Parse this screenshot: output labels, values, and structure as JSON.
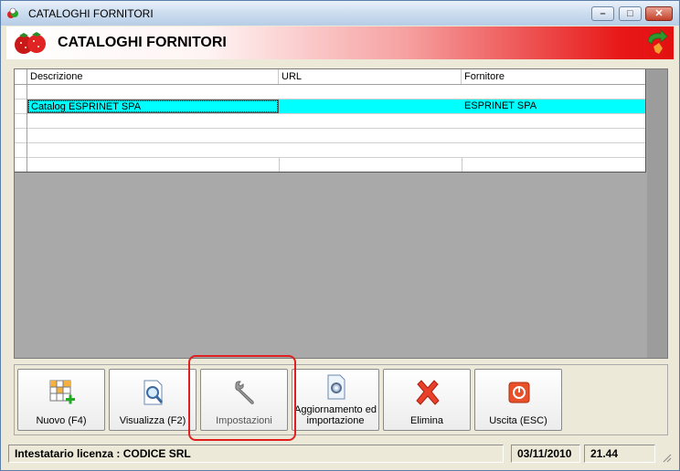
{
  "window": {
    "title": "CATALOGHI FORNITORI"
  },
  "header": {
    "title": "CATALOGHI FORNITORI"
  },
  "grid": {
    "columns": [
      "Descrizione",
      "URL",
      "Fornitore"
    ],
    "rows": [
      {
        "descrizione": "Catalog ESPRINET SPA",
        "url": "",
        "fornitore": "ESPRINET SPA",
        "selected": true
      }
    ]
  },
  "toolbar": {
    "buttons": [
      {
        "label": "Nuovo (F4)",
        "icon": "grid-add-icon"
      },
      {
        "label": "Visualizza (F2)",
        "icon": "magnifier-document-icon"
      },
      {
        "label": "Impostazioni",
        "icon": "wrench-icon"
      },
      {
        "label": "Aggiornamento ed importazione",
        "icon": "document-gear-icon"
      },
      {
        "label": "Elimina",
        "icon": "red-x-icon"
      },
      {
        "label": "Uscita (ESC)",
        "icon": "power-icon"
      }
    ]
  },
  "statusbar": {
    "license": "Intestatario licenza : CODICE SRL",
    "date": "03/11/2010",
    "time": "21.44"
  },
  "colors": {
    "selection": "#00ffff",
    "header_red": "#e31010",
    "highlight_ring": "#e02020"
  }
}
